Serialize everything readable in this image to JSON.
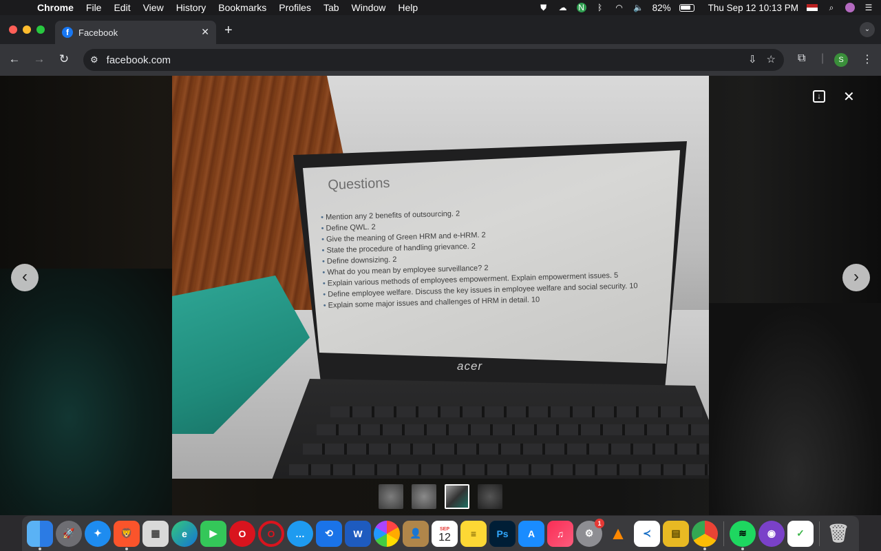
{
  "menubar": {
    "apple": "",
    "items": [
      "Chrome",
      "File",
      "Edit",
      "View",
      "History",
      "Bookmarks",
      "Profiles",
      "Tab",
      "Window",
      "Help"
    ],
    "battery": "82%",
    "datetime": "Thu Sep 12  10:13 PM"
  },
  "tab": {
    "title": "Facebook",
    "close": "✕",
    "new_tab": "+"
  },
  "toolbar": {
    "url": "facebook.com",
    "profile_initial": "S"
  },
  "slide": {
    "title": "Questions",
    "items": [
      "Mention any 2 benefits of outsourcing. 2",
      "Define QWL. 2",
      "Give the meaning of Green HRM and e-HRM. 2",
      "State the procedure of handling grievance. 2",
      "Define downsizing. 2",
      "What do you mean by employee surveillance? 2",
      "Explain various methods of employees empowerment. Explain empowerment issues. 5",
      "Define employee welfare. Discuss the key issues in employee welfare and social security. 10",
      "Explain some major issues and challenges of HRM in detail. 10"
    ],
    "laptop_brand": "acer"
  },
  "viewer": {
    "prev": "‹",
    "next": "›",
    "close": "✕"
  },
  "dock": {
    "calendar_month": "SEP",
    "calendar_day": "12",
    "photoshop": "Ps",
    "word": "W",
    "settings_badge": "1"
  }
}
